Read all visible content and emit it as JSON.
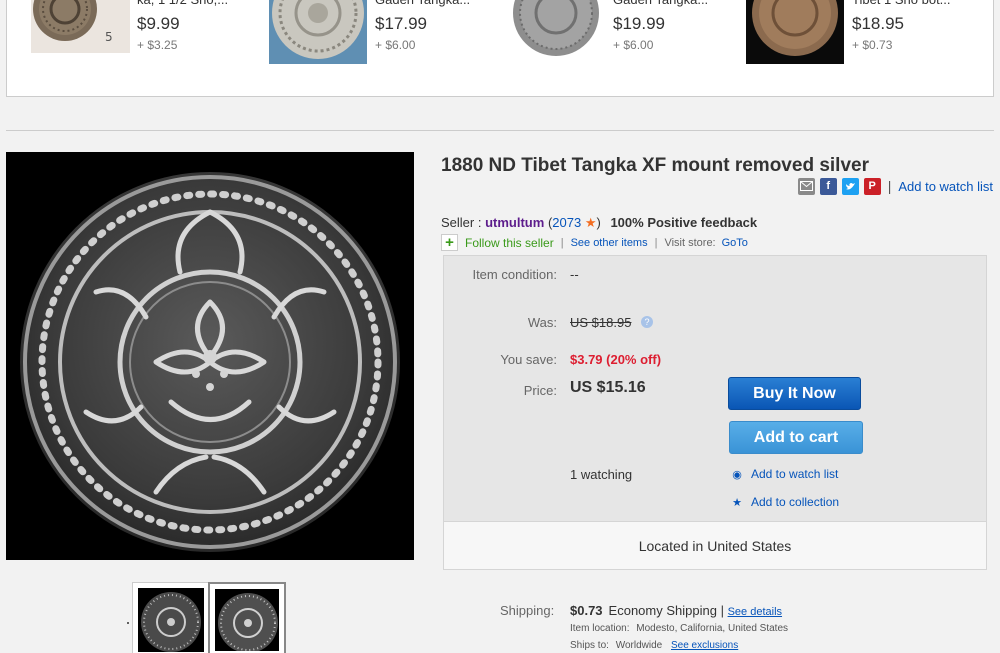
{
  "related": [
    {
      "title": "ka, 1 1/2 Sho,...",
      "price": "$9.99",
      "shipping": "+ $3.25"
    },
    {
      "title": "Gaden Tangka...",
      "price": "$17.99",
      "shipping": "+ $6.00"
    },
    {
      "title": "Gaden Tangka...",
      "price": "$19.99",
      "shipping": "+ $6.00"
    },
    {
      "title": "Tibet 1 Sho bot...",
      "price": "$18.95",
      "shipping": "+ $0.73"
    }
  ],
  "item": {
    "title": "1880 ND Tibet Tangka XF mount removed silver"
  },
  "share": {
    "email_icon": "email-icon",
    "facebook_icon": "facebook-icon",
    "twitter_icon": "twitter-icon",
    "pinterest_icon": "pinterest-icon",
    "watch_link": "Add to watch list",
    "separator": "|"
  },
  "seller": {
    "label": "Seller :",
    "name": "utmultum",
    "score": "2073",
    "feedback": "100% Positive feedback",
    "follow": "Follow this seller",
    "see_other": "See other items",
    "visit_store": "Visit store:",
    "goto": "GoTo"
  },
  "buybox": {
    "condition_label": "Item condition:",
    "condition_value": "--",
    "was_label": "Was:",
    "was_value": "US $18.95",
    "save_label": "You save:",
    "save_value": "$3.79 (20% off)",
    "price_label": "Price:",
    "price_value": "US $15.16",
    "buy_now": "Buy It Now",
    "add_to_cart": "Add to cart",
    "watching": "1 watching",
    "watch_link": "Add to watch list",
    "collection_link": "Add to collection",
    "located": "Located in United States",
    "help_mark": "?"
  },
  "shipping": {
    "label": "Shipping:",
    "price": "$0.73",
    "method": "Economy Shipping",
    "separator": "|",
    "details_link": "See details",
    "location_label": "Item location:",
    "location_value": "Modesto, California, United States",
    "ships_to_label": "Ships to:",
    "ships_to_value": "Worldwide",
    "exclusions_link": "See exclusions"
  },
  "colors": {
    "link": "#0654ba",
    "seller": "#5d1d8c",
    "save": "#dd1e31",
    "follow": "#3a9a1a",
    "buy_button": "#0a56b5",
    "cart_button": "#3a93d6"
  }
}
